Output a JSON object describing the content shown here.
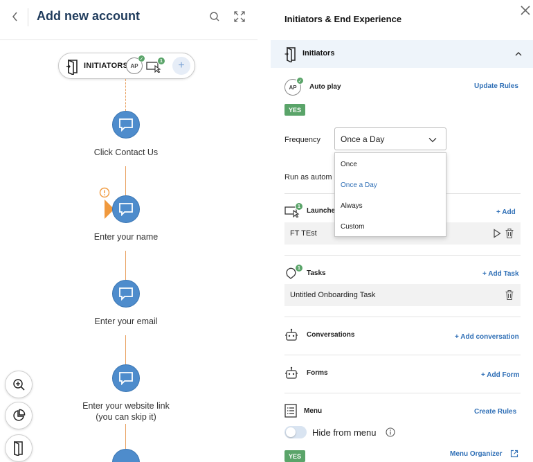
{
  "left": {
    "title": "Add new account",
    "initiators_label": "INITIATORS",
    "ap_badge": "AP",
    "launcher_count": "1",
    "add_symbol": "+",
    "steps": [
      {
        "label": "Click Contact Us"
      },
      {
        "label": "Enter your name"
      },
      {
        "label": "Enter your email"
      },
      {
        "label": "Enter your website link (you can skip it)"
      }
    ]
  },
  "right": {
    "title": "Initiators & End Experience",
    "section": "Initiators",
    "autoplay": {
      "ap": "AP",
      "label": "Auto play",
      "update_link": "Update Rules",
      "yes": "YES"
    },
    "frequency": {
      "label": "Frequency",
      "selected": "Once a Day",
      "options": [
        "Once",
        "Once a Day",
        "Always",
        "Custom"
      ]
    },
    "run_as": "Run as autom",
    "launchers": {
      "label": "Launche",
      "count": "1",
      "add": "+ Add",
      "item": "FT TEst"
    },
    "tasks": {
      "label": "Tasks",
      "count": "1",
      "add": "+ Add Task",
      "item": "Untitled Onboarding Task"
    },
    "conversations": {
      "label": "Conversations",
      "add": "+ Add conversation"
    },
    "forms": {
      "label": "Forms",
      "add": "+ Add Form"
    },
    "menu": {
      "label": "Menu",
      "create": "Create Rules",
      "hide_label": "Hide from menu",
      "yes": "YES",
      "organizer": "Menu Organizer"
    }
  },
  "colors": {
    "accent": "#2f6fb6",
    "node": "#4e8ccc",
    "flow": "#e8a060",
    "success": "#5aa469",
    "warning": "#f0993d"
  }
}
